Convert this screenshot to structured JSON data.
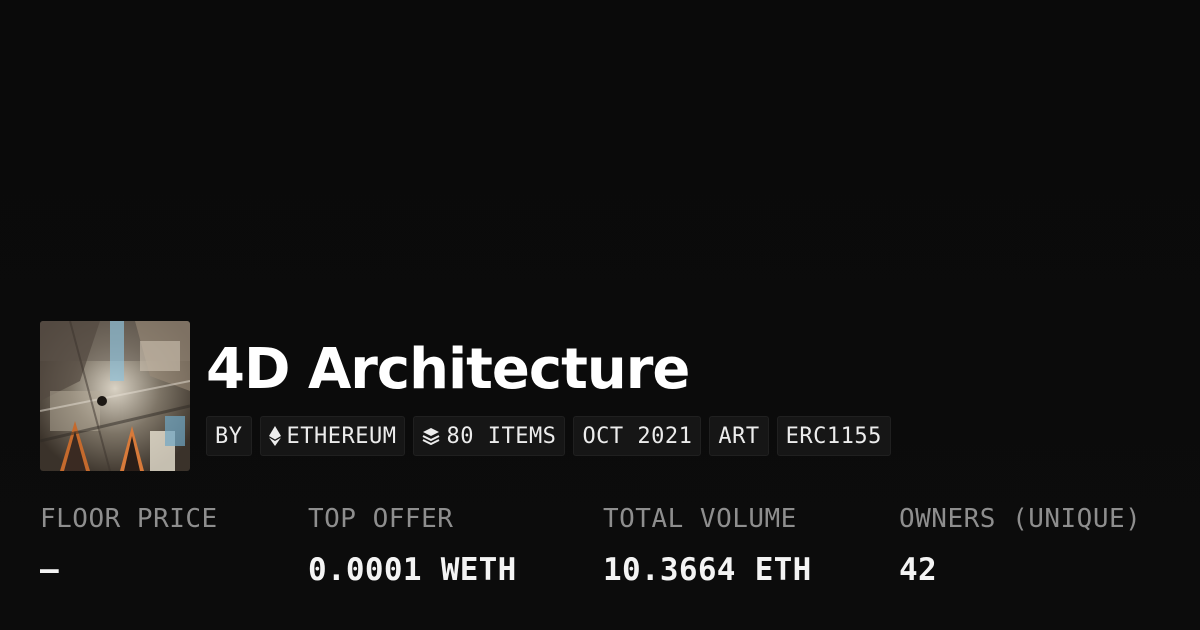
{
  "collection": {
    "name": "4D Architecture",
    "thumbnail": "4D Architecture collection artwork"
  },
  "tags": [
    {
      "label": "BY",
      "icon": null
    },
    {
      "label": "ETHEREUM",
      "icon": "ethereum-icon"
    },
    {
      "label": "80 ITEMS",
      "icon": "layers-icon"
    },
    {
      "label": "OCT 2021",
      "icon": null
    },
    {
      "label": "ART",
      "icon": null
    },
    {
      "label": "ERC1155",
      "icon": null
    }
  ],
  "stats": {
    "floor_price": {
      "label": "FLOOR PRICE",
      "value": "—"
    },
    "top_offer": {
      "label": "TOP OFFER",
      "value": "0.0001 WETH"
    },
    "total_volume": {
      "label": "TOTAL VOLUME",
      "value": "10.3664 ETH"
    },
    "owners": {
      "label": "OWNERS (UNIQUE)",
      "value": "42"
    }
  },
  "colors": {
    "background": "#0b0b0b",
    "tag_background": "#161616",
    "label_gray": "#8e8e8e",
    "text": "#ffffff"
  }
}
